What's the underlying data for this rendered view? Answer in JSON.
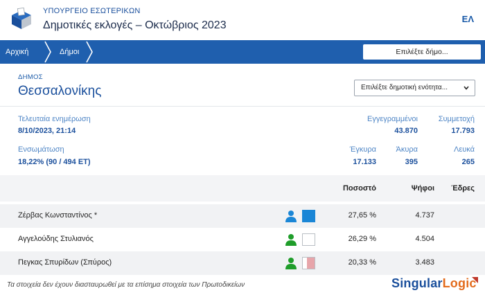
{
  "header": {
    "ministry": "ΥΠΟΥΡΓΕΙΟ ΕΣΩΤΕΡΙΚΩΝ",
    "title": "Δημοτικές εκλογές – Οκτώβριος 2023",
    "language": "ΕΛ",
    "logo_icon": "ballot-box-icon"
  },
  "nav": {
    "home": "Αρχική",
    "municipalities": "Δήμοι",
    "municipality_select": "Επιλέξτε δήμο..."
  },
  "municipality": {
    "section_label": "ΔΗΜΟΣ",
    "name": "Θεσσαλονίκης",
    "unit_select": "Επιλέξτε δημοτική ενότητα..."
  },
  "stats": {
    "last_update_label": "Τελευταία ενημέρωση",
    "last_update_value": "8/10/2023, 21:14",
    "integration_label": "Ενσωμάτωση",
    "integration_value": "18,22% (90 / 494 ΕΤ)",
    "registered_label": "Εγγεγραμμένοι",
    "registered_value": "43.870",
    "turnout_label": "Συμμετοχή",
    "turnout_value": "17.793",
    "valid_label": "Έγκυρα",
    "valid_value": "17.133",
    "invalid_label": "Άκυρα",
    "invalid_value": "395",
    "blank_label": "Λευκά",
    "blank_value": "265"
  },
  "table": {
    "col_percent": "Ποσοστό",
    "col_votes": "Ψήφοι",
    "col_seats": "Έδρες",
    "rows": [
      {
        "name": "Ζέρβας Κωνσταντίνος *",
        "percent": "27,65 %",
        "votes": "4.737",
        "person_color": "#1a86d6",
        "swatch": "blue"
      },
      {
        "name": "Αγγελούδης Στυλιανός",
        "percent": "26,29 %",
        "votes": "4.504",
        "person_color": "#1f9d2a",
        "swatch": "white"
      },
      {
        "name": "Πεγκας Σπυρίδων (Σπύρος)",
        "percent": "20,33 %",
        "votes": "3.483",
        "person_color": "#1f9d2a",
        "swatch": "pink"
      }
    ]
  },
  "footer": {
    "note": "Τα στοιχεία δεν έχουν διασταυρωθεί με τα επίσημα στοιχεία των Πρωτοδικείων",
    "brand_part1": "Singular",
    "brand_part2": "Logic"
  },
  "colors": {
    "nav_bg": "#1f5fae",
    "link_blue": "#1a4f9c",
    "label_blue": "#4f86c6",
    "brand_orange": "#e36b1c"
  }
}
